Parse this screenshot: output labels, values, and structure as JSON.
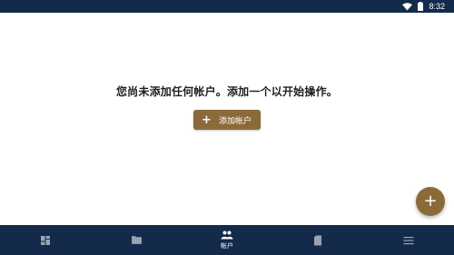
{
  "status_bar": {
    "time": "8:32",
    "icons": [
      "wifi-icon",
      "battery-icon"
    ]
  },
  "empty_state": {
    "message": "您尚未添加任何帐户。添加一个以开始操作。",
    "button_label": "添加帐户",
    "button_icon": "plus-icon"
  },
  "fab": {
    "icon": "plus-icon",
    "symbol": "+"
  },
  "bottom_nav": {
    "items": [
      {
        "icon": "dashboard-icon",
        "label": ""
      },
      {
        "icon": "folder-icon",
        "label": ""
      },
      {
        "icon": "people-icon",
        "label": "帐户",
        "active": true
      },
      {
        "icon": "sd-card-icon",
        "label": ""
      },
      {
        "icon": "menu-icon",
        "label": ""
      }
    ]
  },
  "colors": {
    "bar_background": "#142a4a",
    "accent": "#8b6a3a",
    "nav_inactive": "#9aa3b2"
  }
}
